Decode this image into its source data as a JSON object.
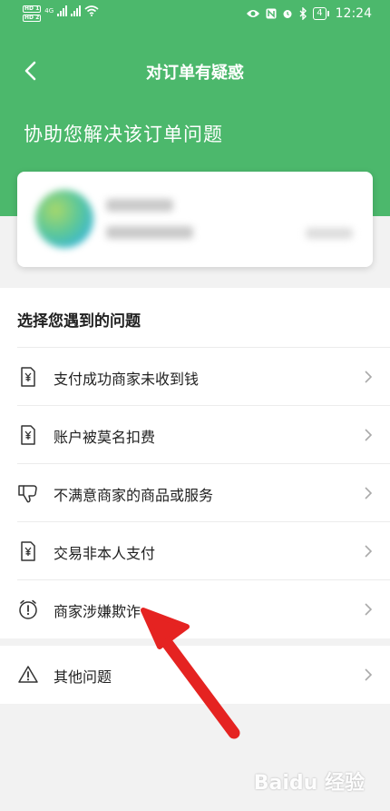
{
  "status_bar": {
    "time": "12:24",
    "battery": "4",
    "network": "4G"
  },
  "nav": {
    "title": "对订单有疑惑"
  },
  "headline": "协助您解决该订单问题",
  "section_title": "选择您遇到的问题",
  "issues": [
    {
      "label": "支付成功商家未收到钱",
      "icon": "receipt-yuan-icon"
    },
    {
      "label": "账户被莫名扣费",
      "icon": "receipt-yuan-icon"
    },
    {
      "label": "不满意商家的商品或服务",
      "icon": "thumbs-down-icon"
    },
    {
      "label": "交易非本人支付",
      "icon": "receipt-yuan-icon"
    },
    {
      "label": "商家涉嫌欺诈",
      "icon": "alert-alarm-icon"
    }
  ],
  "other_issue": {
    "label": "其他问题",
    "icon": "warning-triangle-icon"
  },
  "watermark": "Baidu 经验",
  "colors": {
    "brand_green": "#4cb86c",
    "annotation_arrow": "#e52321"
  }
}
